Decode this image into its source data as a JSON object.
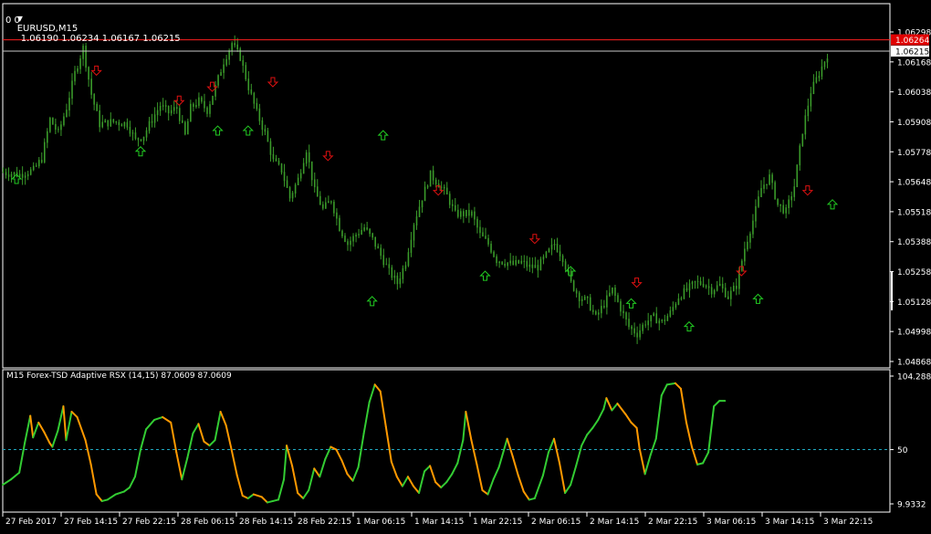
{
  "header": {
    "menu_glyph": "▼",
    "symbol_tf": "EURUSD,M15",
    "ohlc": "1.06190 1.06234 1.06167 1.06215",
    "sub": "0 0"
  },
  "colors": {
    "background": "#000000",
    "frame": "#ffffff",
    "candle": "#3a9a2a",
    "price_line": "#c8c8c8",
    "ask_line": "#ff2020",
    "ask_tag": "#e00000",
    "arrow_up": "#22cc22",
    "arrow_down": "#dd1111",
    "rsx_up": "#33cc33",
    "rsx_down": "#ff9900",
    "level": "#1fa8c0"
  },
  "main_chart": {
    "price_ticks": [
      "1.06298",
      "1.06168",
      "1.06038",
      "1.05908",
      "1.05778",
      "1.05648",
      "1.05518",
      "1.05388",
      "1.05258",
      "1.05128",
      "1.04998",
      "1.04868"
    ],
    "ask_tag": "1.06264",
    "bid_tag": "1.06215"
  },
  "indicator": {
    "title": "M15 Forex-TSD Adaptive RSX (14,15) 87.0609 87.0609",
    "ticks": [
      "104.2889",
      "50",
      "9.9332"
    ]
  },
  "time_axis": [
    "27 Feb 2017",
    "27 Feb 14:15",
    "27 Feb 22:15",
    "28 Feb 06:15",
    "28 Feb 14:15",
    "28 Feb 22:15",
    "1 Mar 06:15",
    "1 Mar 14:15",
    "1 Mar 22:15",
    "2 Mar 06:15",
    "2 Mar 14:15",
    "2 Mar 22:15",
    "3 Mar 06:15",
    "3 Mar 14:15",
    "3 Mar 22:15"
  ],
  "chart_data": [
    {
      "type": "candlestick",
      "title": "EURUSD,M15",
      "y_label": "",
      "ylim": [
        1.04868,
        1.06298
      ],
      "x_labels": [
        "27 Feb 2017",
        "27 Feb 14:15",
        "27 Feb 22:15",
        "28 Feb 06:15",
        "28 Feb 14:15",
        "28 Feb 22:15",
        "1 Mar 06:15",
        "1 Mar 14:15",
        "1 Mar 22:15",
        "2 Mar 06:15",
        "2 Mar 14:15",
        "2 Mar 22:15",
        "3 Mar 06:15",
        "3 Mar 14:15",
        "3 Mar 22:15"
      ],
      "price_path": [
        [
          0,
          1.0569
        ],
        [
          6,
          1.0568
        ],
        [
          11,
          1.057
        ],
        [
          14,
          1.0575
        ],
        [
          17,
          1.0592
        ],
        [
          20,
          1.0586
        ],
        [
          23,
          1.0597
        ],
        [
          26,
          1.0612
        ],
        [
          29,
          1.0623
        ],
        [
          32,
          1.0603
        ],
        [
          35,
          1.059
        ],
        [
          40,
          1.0591
        ],
        [
          45,
          1.059
        ],
        [
          48,
          1.0583
        ],
        [
          51,
          1.0585
        ],
        [
          54,
          1.0592
        ],
        [
          57,
          1.0598
        ],
        [
          60,
          1.0595
        ],
        [
          63,
          1.0597
        ],
        [
          66,
          1.0585
        ],
        [
          68,
          1.0597
        ],
        [
          71,
          1.06
        ],
        [
          74,
          1.0596
        ],
        [
          77,
          1.0606
        ],
        [
          80,
          1.0617
        ],
        [
          83,
          1.0625
        ],
        [
          86,
          1.0619
        ],
        [
          89,
          1.0606
        ],
        [
          92,
          1.0595
        ],
        [
          95,
          1.0586
        ],
        [
          98,
          1.0574
        ],
        [
          101,
          1.057
        ],
        [
          104,
          1.0558
        ],
        [
          107,
          1.0566
        ],
        [
          110,
          1.0579
        ],
        [
          113,
          1.0561
        ],
        [
          116,
          1.0553
        ],
        [
          119,
          1.0557
        ],
        [
          122,
          1.0545
        ],
        [
          125,
          1.0538
        ],
        [
          128,
          1.0542
        ],
        [
          131,
          1.0545
        ],
        [
          134,
          1.054
        ],
        [
          137,
          1.0533
        ],
        [
          140,
          1.0526
        ],
        [
          143,
          1.0521
        ],
        [
          146,
          1.053
        ],
        [
          149,
          1.0547
        ],
        [
          152,
          1.0558
        ],
        [
          155,
          1.0568
        ],
        [
          158,
          1.0564
        ],
        [
          161,
          1.0559
        ],
        [
          164,
          1.0551
        ],
        [
          167,
          1.0551
        ],
        [
          170,
          1.0551
        ],
        [
          173,
          1.0542
        ],
        [
          176,
          1.0538
        ],
        [
          179,
          1.0531
        ],
        [
          182,
          1.053
        ],
        [
          185,
          1.0529
        ],
        [
          188,
          1.053
        ],
        [
          191,
          1.0528
        ],
        [
          194,
          1.0528
        ],
        [
          197,
          1.0533
        ],
        [
          200,
          1.0538
        ],
        [
          203,
          1.0532
        ],
        [
          206,
          1.0521
        ],
        [
          209,
          1.0515
        ],
        [
          212,
          1.0513
        ],
        [
          215,
          1.0506
        ],
        [
          218,
          1.0512
        ],
        [
          221,
          1.0518
        ],
        [
          224,
          1.051
        ],
        [
          227,
          1.0502
        ],
        [
          230,
          1.0499
        ],
        [
          233,
          1.0504
        ],
        [
          236,
          1.0506
        ],
        [
          239,
          1.0504
        ],
        [
          242,
          1.0508
        ],
        [
          245,
          1.0515
        ],
        [
          248,
          1.0518
        ],
        [
          251,
          1.0521
        ],
        [
          254,
          1.0521
        ],
        [
          257,
          1.0518
        ],
        [
          260,
          1.052
        ],
        [
          263,
          1.0515
        ],
        [
          266,
          1.052
        ],
        [
          269,
          1.0536
        ],
        [
          272,
          1.0548
        ],
        [
          275,
          1.0562
        ],
        [
          278,
          1.0567
        ],
        [
          281,
          1.0555
        ],
        [
          284,
          1.0552
        ],
        [
          287,
          1.0563
        ],
        [
          290,
          1.0587
        ],
        [
          293,
          1.0604
        ],
        [
          296,
          1.0612
        ],
        [
          299,
          1.062
        ]
      ],
      "last_price": 1.06215,
      "ask_price": 1.06264,
      "signals_up": [
        [
          5,
          1.0566
        ],
        [
          50,
          1.0578
        ],
        [
          78,
          1.0587
        ],
        [
          89,
          1.0587
        ],
        [
          134,
          1.0513
        ],
        [
          138,
          1.0585
        ],
        [
          175,
          1.0524
        ],
        [
          206,
          1.0526
        ],
        [
          228,
          1.0512
        ],
        [
          249,
          1.0502
        ],
        [
          274,
          1.0514
        ],
        [
          301,
          1.0555
        ]
      ],
      "signals_down": [
        [
          34,
          1.0613
        ],
        [
          64,
          1.06
        ],
        [
          76,
          1.0606
        ],
        [
          98,
          1.0608
        ],
        [
          118,
          1.0576
        ],
        [
          158,
          1.0561
        ],
        [
          193,
          1.054
        ],
        [
          230,
          1.0521
        ],
        [
          268,
          1.0526
        ],
        [
          292,
          1.0561
        ]
      ]
    },
    {
      "type": "line",
      "title": "M15 Forex-TSD Adaptive RSX (14,15) 87.0609 87.0609",
      "ylim": [
        9.9332,
        104.2889
      ],
      "level": 50,
      "series": [
        {
          "name": "",
          "values": [
            [
              0,
              24
            ],
            [
              3,
              28
            ],
            [
              6,
              33
            ],
            [
              8,
              55
            ],
            [
              10,
              75
            ],
            [
              11,
              59
            ],
            [
              13,
              70
            ],
            [
              15,
              63
            ],
            [
              17,
              55
            ],
            [
              18,
              52
            ],
            [
              20,
              64
            ],
            [
              22,
              82
            ],
            [
              23,
              57
            ],
            [
              25,
              78
            ],
            [
              27,
              74
            ],
            [
              30,
              57
            ],
            [
              32,
              39
            ],
            [
              34,
              17
            ],
            [
              36,
              12
            ],
            [
              38,
              13
            ],
            [
              41,
              17
            ],
            [
              44,
              19
            ],
            [
              46,
              22
            ],
            [
              48,
              30
            ],
            [
              50,
              50
            ],
            [
              52,
              65
            ],
            [
              55,
              72
            ],
            [
              58,
              74
            ],
            [
              61,
              70
            ],
            [
              63,
              48
            ],
            [
              65,
              28
            ],
            [
              67,
              44
            ],
            [
              69,
              62
            ],
            [
              71,
              69
            ],
            [
              73,
              56
            ],
            [
              75,
              53
            ],
            [
              77,
              57
            ],
            [
              79,
              78
            ],
            [
              81,
              68
            ],
            [
              83,
              50
            ],
            [
              85,
              31
            ],
            [
              87,
              16
            ],
            [
              89,
              14
            ],
            [
              91,
              17
            ],
            [
              94,
              15
            ],
            [
              96,
              11
            ],
            [
              98,
              12
            ],
            [
              100,
              13
            ],
            [
              102,
              28
            ],
            [
              103,
              53
            ],
            [
              105,
              38
            ],
            [
              107,
              18
            ],
            [
              109,
              14
            ],
            [
              111,
              20
            ],
            [
              113,
              36
            ],
            [
              115,
              30
            ],
            [
              117,
              43
            ],
            [
              119,
              52
            ],
            [
              121,
              50
            ],
            [
              123,
              42
            ],
            [
              125,
              32
            ],
            [
              127,
              27
            ],
            [
              129,
              37
            ],
            [
              131,
              62
            ],
            [
              133,
              85
            ],
            [
              135,
              98
            ],
            [
              137,
              93
            ],
            [
              139,
              67
            ],
            [
              141,
              41
            ],
            [
              143,
              30
            ],
            [
              145,
              23
            ],
            [
              147,
              30
            ],
            [
              149,
              23
            ],
            [
              151,
              18
            ],
            [
              153,
              34
            ],
            [
              155,
              38
            ],
            [
              157,
              26
            ],
            [
              159,
              22
            ],
            [
              161,
              26
            ],
            [
              163,
              32
            ],
            [
              165,
              40
            ],
            [
              167,
              57
            ],
            [
              168,
              78
            ],
            [
              170,
              57
            ],
            [
              172,
              39
            ],
            [
              174,
              20
            ],
            [
              176,
              17
            ],
            [
              178,
              28
            ],
            [
              180,
              37
            ],
            [
              183,
              58
            ],
            [
              185,
              45
            ],
            [
              187,
              31
            ],
            [
              189,
              19
            ],
            [
              191,
              13
            ],
            [
              193,
              14
            ],
            [
              196,
              31
            ],
            [
              198,
              48
            ],
            [
              200,
              58
            ],
            [
              202,
              40
            ],
            [
              204,
              18
            ],
            [
              206,
              24
            ],
            [
              208,
              38
            ],
            [
              210,
              53
            ],
            [
              212,
              61
            ],
            [
              214,
              66
            ],
            [
              216,
              72
            ],
            [
              218,
              80
            ],
            [
              219,
              88
            ],
            [
              221,
              79
            ],
            [
              223,
              84
            ],
            [
              226,
              76
            ],
            [
              228,
              70
            ],
            [
              230,
              66
            ],
            [
              231,
              51
            ],
            [
              233,
              32
            ],
            [
              235,
              46
            ],
            [
              237,
              58
            ],
            [
              239,
              90
            ],
            [
              241,
              98
            ],
            [
              244,
              99
            ],
            [
              246,
              95
            ],
            [
              248,
              70
            ],
            [
              250,
              52
            ],
            [
              252,
              39
            ],
            [
              254,
              40
            ],
            [
              256,
              48
            ],
            [
              258,
              82
            ],
            [
              260,
              86
            ],
            [
              262,
              86
            ]
          ]
        }
      ]
    }
  ]
}
